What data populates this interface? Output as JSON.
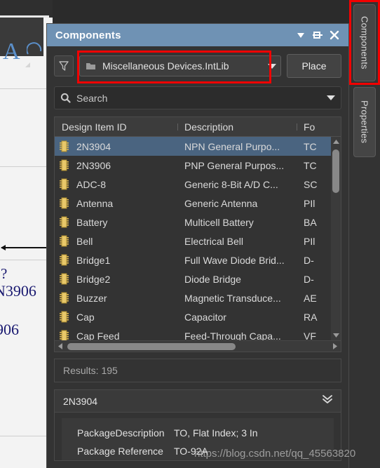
{
  "colors": {
    "panel_bg": "#333333",
    "title_bar": "#6f92b4",
    "selection": "#4a6480",
    "highlight_box": "#f20000",
    "row_icon": "#e8c86a",
    "text": "#dadada"
  },
  "background_editor": {
    "tool_a_label": "A",
    "text_fragments": [
      "?",
      "N3906",
      "906"
    ]
  },
  "tabstrip": {
    "tabs": [
      {
        "label": "Components",
        "selected": true
      },
      {
        "label": "Properties",
        "selected": false
      }
    ]
  },
  "panel": {
    "title": "Components",
    "title_buttons": [
      {
        "name": "dropdown-menu-icon",
        "glyph": "▼"
      },
      {
        "name": "pin-icon",
        "glyph": "pin"
      },
      {
        "name": "close-icon",
        "glyph": "✕"
      }
    ],
    "filter": {
      "filter_icon_name": "funnel-icon",
      "library_icon_name": "library-icon",
      "library_value": "Miscellaneous Devices.IntLib",
      "place_label": "Place"
    },
    "search": {
      "placeholder": "Search",
      "value": "Search",
      "icon_name": "search-icon"
    },
    "table": {
      "columns": [
        "Design Item ID",
        "Description",
        "Fo"
      ],
      "rows": [
        {
          "id": "2N3904",
          "description": "NPN General Purpo...",
          "footprint": "TC",
          "selected": true
        },
        {
          "id": "2N3906",
          "description": "PNP General Purpos...",
          "footprint": "TC",
          "selected": false
        },
        {
          "id": "ADC-8",
          "description": "Generic 8-Bit A/D C...",
          "footprint": "SC",
          "selected": false
        },
        {
          "id": "Antenna",
          "description": "Generic Antenna",
          "footprint": "PIl",
          "selected": false
        },
        {
          "id": "Battery",
          "description": "Multicell Battery",
          "footprint": "BA",
          "selected": false
        },
        {
          "id": "Bell",
          "description": "Electrical Bell",
          "footprint": "PIl",
          "selected": false
        },
        {
          "id": "Bridge1",
          "description": "Full Wave Diode Brid...",
          "footprint": "D-",
          "selected": false
        },
        {
          "id": "Bridge2",
          "description": "Diode Bridge",
          "footprint": "D-",
          "selected": false
        },
        {
          "id": "Buzzer",
          "description": "Magnetic Transduce...",
          "footprint": "AE",
          "selected": false
        },
        {
          "id": "Cap",
          "description": "Capacitor",
          "footprint": "RA",
          "selected": false
        },
        {
          "id": "Cap Feed",
          "description": "Feed-Through Capa...",
          "footprint": "VF",
          "selected": false
        }
      ]
    },
    "results": "Results: 195",
    "detail": {
      "title": "2N3904",
      "expand_icon_name": "chevron-double-down-icon",
      "rows": [
        {
          "key": "PackageDescription",
          "value": "TO, Flat Index; 3 In"
        },
        {
          "key": "Package Reference",
          "value": "TO-92A"
        }
      ]
    }
  },
  "watermark": "https://blog.csdn.net/qq_45563820"
}
